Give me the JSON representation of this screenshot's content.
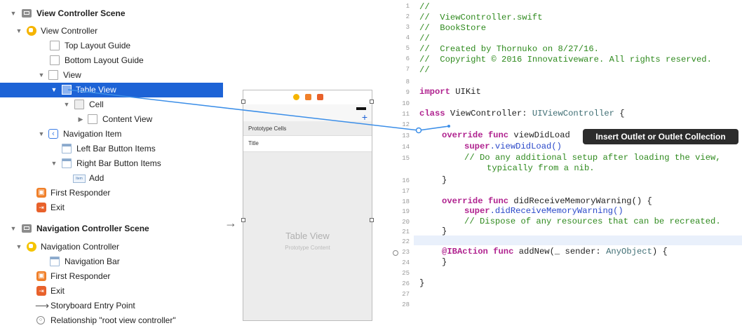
{
  "outline": {
    "items": [
      {
        "label": "View Controller Scene"
      },
      {
        "label": "View Controller"
      },
      {
        "label": "Top Layout Guide"
      },
      {
        "label": "Bottom Layout Guide"
      },
      {
        "label": "View"
      },
      {
        "label": "Table View"
      },
      {
        "label": "Cell"
      },
      {
        "label": "Content View"
      },
      {
        "label": "Navigation Item"
      },
      {
        "label": "Left Bar Button Items"
      },
      {
        "label": "Right Bar Button Items"
      },
      {
        "label": "Add"
      },
      {
        "label": "First Responder"
      },
      {
        "label": "Exit"
      },
      {
        "label": "Navigation Controller Scene"
      },
      {
        "label": "Navigation Controller"
      },
      {
        "label": "Navigation Bar"
      },
      {
        "label": "First Responder"
      },
      {
        "label": "Exit"
      },
      {
        "label": "Storyboard Entry Point"
      },
      {
        "label": "Relationship \"root view controller\""
      }
    ],
    "add_icon_text": "Item",
    "selected": "Table View"
  },
  "canvas": {
    "prototype_cells": "Prototype Cells",
    "title_cell": "Title",
    "table_view": "Table View",
    "prototype_content": "Prototype Content"
  },
  "editor": {
    "line_numbers": [
      "1",
      "2",
      "3",
      "4",
      "5",
      "6",
      "7",
      "8",
      "9",
      "10",
      "11",
      "12",
      "13",
      "14",
      "15",
      "",
      "16",
      "17",
      "18",
      "19",
      "20",
      "21",
      "22",
      "23",
      "24",
      "25",
      "26",
      "27",
      "28"
    ],
    "lines": {
      "l1": "//",
      "l2": "//  ViewController.swift",
      "l3": "//  BookStore",
      "l4": "//",
      "l5": "//  Created by Thornuko on 8/27/16.",
      "l6": "//  Copyright © 2016 Innovativeware. All rights reserved.",
      "l7": "//",
      "l9_kw": "import",
      "l9_rest": " UIKit",
      "l11_kw": "class",
      "l11_name": " ViewController: ",
      "l11_type": "UIViewController",
      "l11_end": " {",
      "l13_kw": "override func",
      "l13_rest": " viewDidLoad",
      "l14_kw": "super",
      "l14_rest": ".viewDidLoad()",
      "l15": "// Do any additional setup after loading the view,",
      "l15b": "typically from a nib.",
      "l16": "}",
      "l18_kw": "override func",
      "l18_rest": " didReceiveMemoryWarning() {",
      "l19_kw": "super",
      "l19_rest": ".didReceiveMemoryWarning()",
      "l20": "// Dispose of any resources that can be recreated.",
      "l21": "}",
      "l23_kw": "@IBAction func",
      "l23_rest": " addNew(_ sender: ",
      "l23_type": "AnyObject",
      "l23_end": ") {",
      "l24": "}",
      "l26": "}"
    },
    "tooltip": "Insert Outlet or Outlet Collection"
  },
  "colors": {
    "selection": "#1d63d6",
    "connection": "#3b8ee8",
    "tooltip_bg": "#2c2c2c",
    "comment": "#2f8a1e",
    "keyword": "#b0238f"
  }
}
